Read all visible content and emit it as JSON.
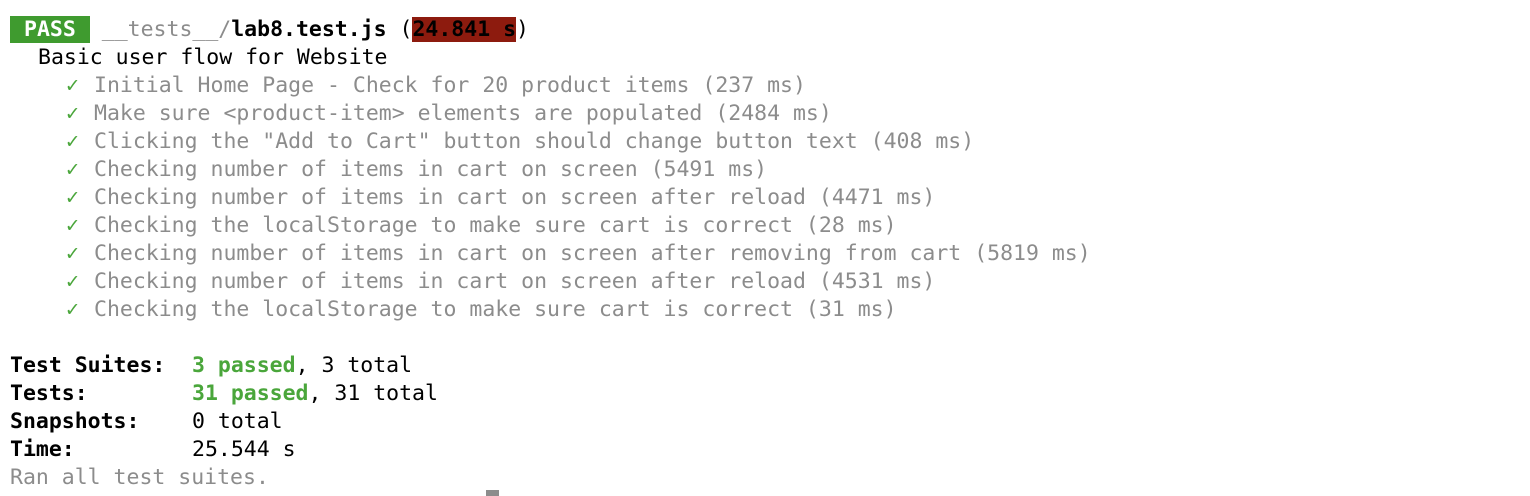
{
  "header": {
    "status": "PASS",
    "path_dim": "__tests__/",
    "file": "lab8.test.js",
    "open_paren": " (",
    "duration": "24.841 s",
    "close_paren": ")"
  },
  "suite": {
    "title": "Basic user flow for Website"
  },
  "tests": [
    {
      "check": "✓",
      "name": "Initial Home Page - Check for 20 product items (237 ms)"
    },
    {
      "check": "✓",
      "name": "Make sure <product-item> elements are populated (2484 ms)"
    },
    {
      "check": "✓",
      "name": "Clicking the \"Add to Cart\" button should change button text (408 ms)"
    },
    {
      "check": "✓",
      "name": "Checking number of items in cart on screen (5491 ms)"
    },
    {
      "check": "✓",
      "name": "Checking number of items in cart on screen after reload (4471 ms)"
    },
    {
      "check": "✓",
      "name": "Checking the localStorage to make sure cart is correct (28 ms)"
    },
    {
      "check": "✓",
      "name": "Checking number of items in cart on screen after removing from cart (5819 ms)"
    },
    {
      "check": "✓",
      "name": "Checking number of items in cart on screen after reload (4531 ms)"
    },
    {
      "check": "✓",
      "name": "Checking the localStorage to make sure cart is correct (31 ms)"
    }
  ],
  "summary": {
    "suites_label": "Test Suites:",
    "suites_passed": "3 passed",
    "suites_total": ", 3 total",
    "tests_label": "Tests:",
    "tests_passed": "31 passed",
    "tests_total": ", 31 total",
    "snapshots_label": "Snapshots:",
    "snapshots_value": "0 total",
    "time_label": "Time:",
    "time_value": "25.544 s",
    "footer": "Ran all test suites."
  },
  "colors": {
    "pass_badge": "#3f9b2f",
    "slow_highlight": "#8d1b0e",
    "check_green": "#4aa63b",
    "dim_text": "#8c8c8c"
  }
}
